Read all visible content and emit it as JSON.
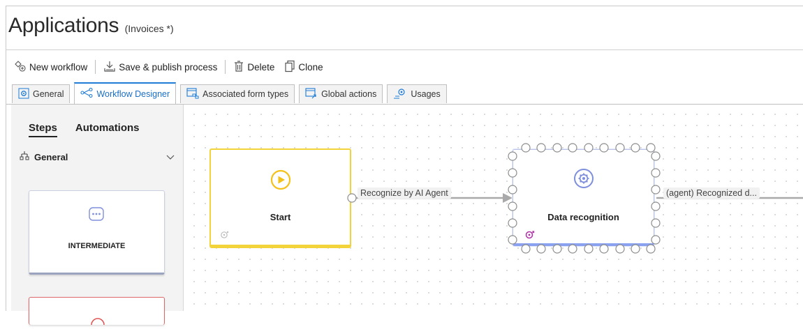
{
  "header": {
    "title": "Applications",
    "subtitle": "(Invoices *)"
  },
  "toolbar": {
    "new_workflow": "New workflow",
    "save_publish": "Save & publish process",
    "delete": "Delete",
    "clone": "Clone"
  },
  "tabs": {
    "general": "General",
    "workflow_designer": "Workflow Designer",
    "associated_form_types": "Associated form types",
    "global_actions": "Global actions",
    "usages": "Usages"
  },
  "panel": {
    "steps": "Steps",
    "automations": "Automations",
    "group": "General",
    "step_cards": [
      "INTERMEDIATE"
    ]
  },
  "canvas": {
    "start_node": "Start",
    "recognition_node": "Data recognition",
    "connector_1": "Recognize by AI Agent",
    "connector_2": "(agent) Recognized d..."
  },
  "colors": {
    "accent": "#1e7bd6",
    "start_border": "#f2d33a",
    "recognition_accent": "#8aa1ef",
    "automation_icon": "#b02fa8",
    "end_card_border": "#dd6666"
  },
  "icons": {
    "new_workflow": "workflow-add-icon",
    "save_publish": "save-publish-icon",
    "delete": "trash-icon",
    "clone": "copy-icon",
    "tab_general": "gear-icon",
    "tab_workflow": "workflow-icon",
    "tab_forms": "form-types-icon",
    "tab_global": "global-actions-icon",
    "tab_usages": "usages-icon",
    "group": "steps-group-icon",
    "intermediate": "ellipsis-icon",
    "start": "play-icon",
    "recognition": "gear-icon",
    "automation": "automation-icon"
  }
}
